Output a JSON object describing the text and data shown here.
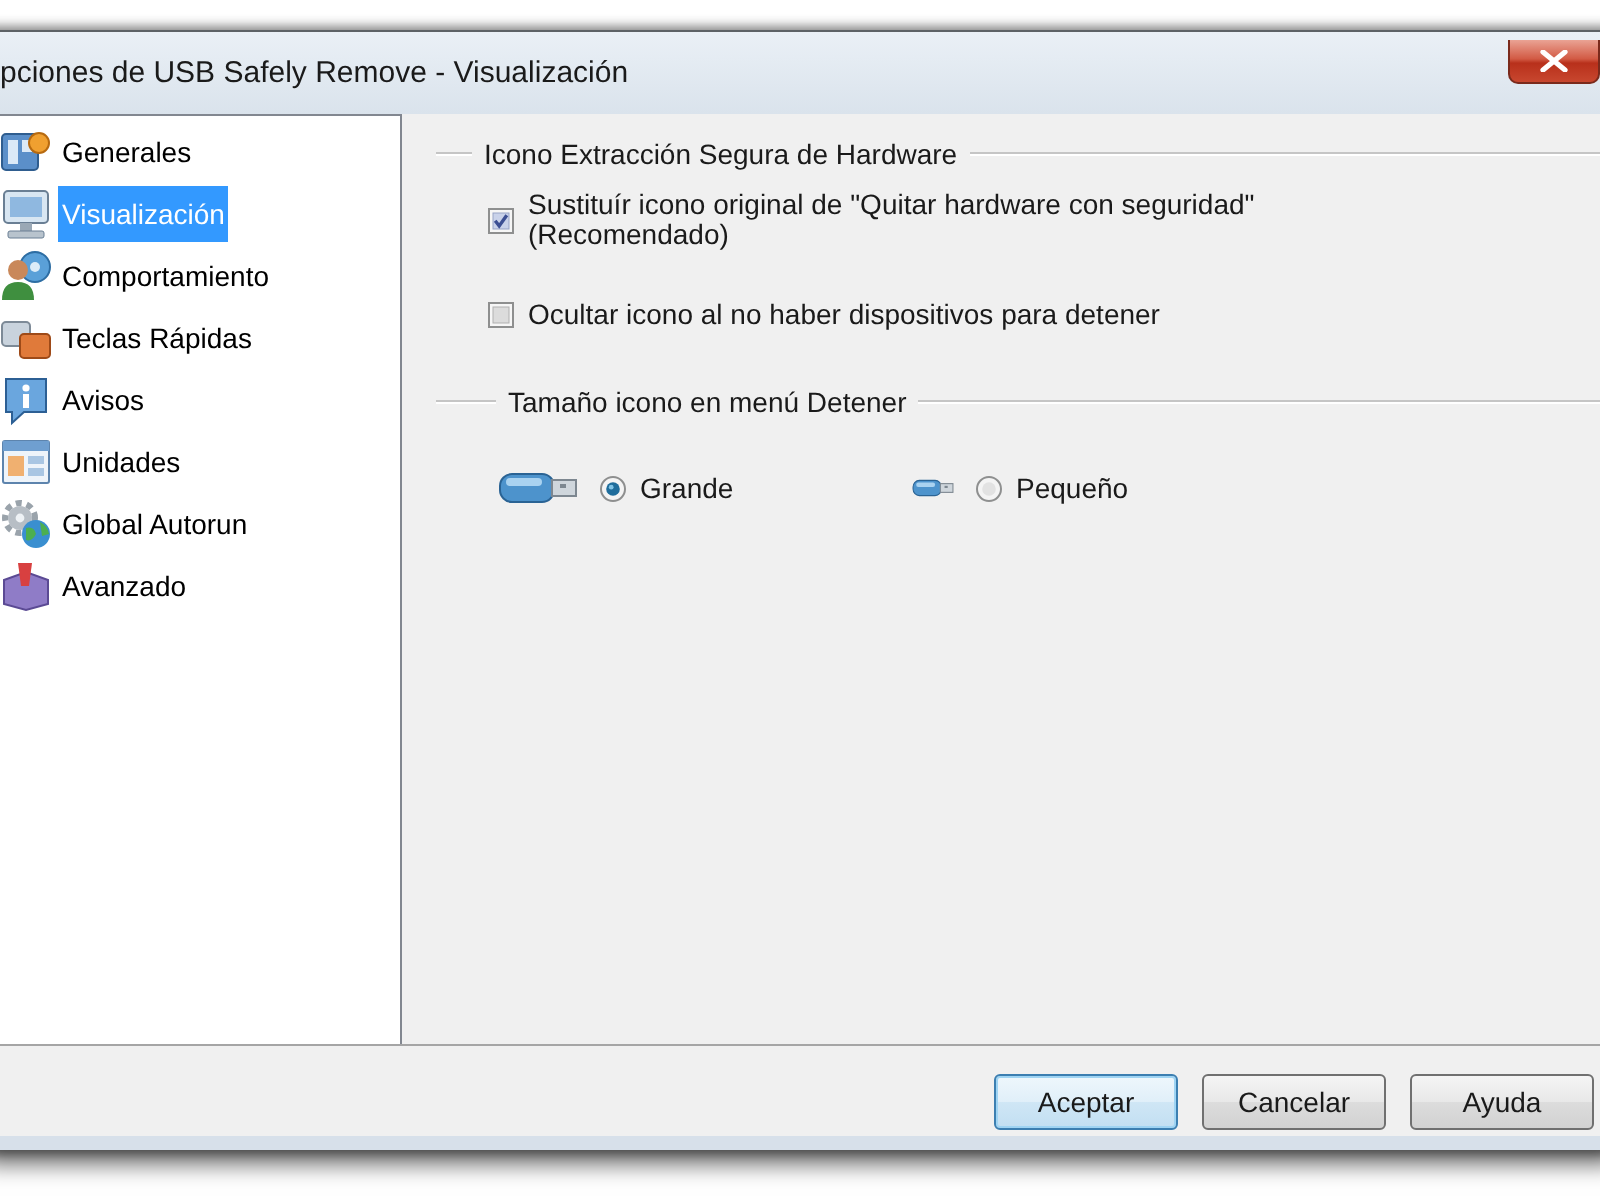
{
  "window": {
    "title": "pciones de USB Safely Remove - Visualización"
  },
  "sidebar": {
    "items": [
      {
        "label": "Generales",
        "selected": false
      },
      {
        "label": "Visualización",
        "selected": true
      },
      {
        "label": "Comportamiento",
        "selected": false
      },
      {
        "label": "Teclas Rápidas",
        "selected": false
      },
      {
        "label": "Avisos",
        "selected": false
      },
      {
        "label": "Unidades",
        "selected": false
      },
      {
        "label": "Global Autorun",
        "selected": false
      },
      {
        "label": "Avanzado",
        "selected": false
      }
    ]
  },
  "groups": [
    {
      "title": "Icono Extracción Segura de Hardware",
      "kind": "checkboxes",
      "options": [
        {
          "label": "Sustituír icono original de \"Quitar hardware con seguridad\" (Recomendado)",
          "checked": true
        },
        {
          "label": "Ocultar icono al no haber dispositivos para detener",
          "checked": false
        }
      ]
    },
    {
      "title": "Tamaño icono en menú Detener",
      "kind": "radios",
      "options": [
        {
          "label": "Grande",
          "selected": true
        },
        {
          "label": "Pequeño",
          "selected": false
        }
      ]
    }
  ],
  "buttons": [
    {
      "label": "Aceptar",
      "focused": true
    },
    {
      "label": "Cancelar",
      "focused": false
    },
    {
      "label": "Ayuda",
      "focused": false
    }
  ]
}
